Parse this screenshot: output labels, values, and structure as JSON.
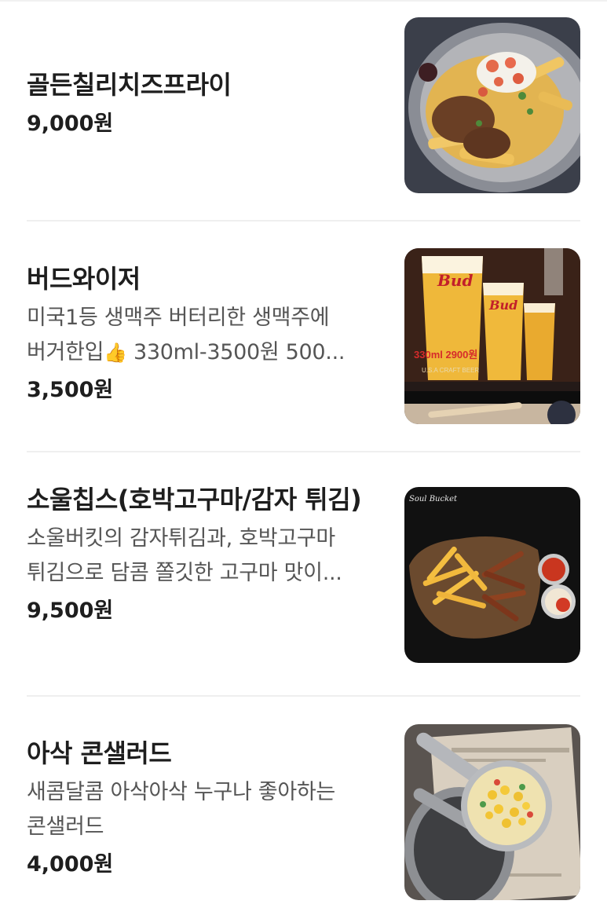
{
  "menu": {
    "items": [
      {
        "name": "골든칠리치즈프라이",
        "description": "",
        "price": "9,000원",
        "image_icon": "chili-cheese-fries-photo"
      },
      {
        "name": "버드와이저",
        "description_line1": "미국1등 생맥주 버터리한 생맥주에",
        "description_line2_prefix": "버거한입",
        "description_emoji": "👍",
        "description_line2_suffix": " 330ml-3500원 500...",
        "price": "3,500원",
        "image_icon": "budweiser-beer-photo",
        "image_text_brand": "Bud",
        "image_text_price": "330ml 2900원",
        "image_text_sub": "U.S.A CRAFT BEER"
      },
      {
        "name": "소울칩스(호박고구마/감자 튀김)",
        "description": "소울버킷의 감자튀김과, 호박고구마 튀김으로 담콤 쫄깃한 고구마 맛이...",
        "price": "9,500원",
        "image_icon": "soul-chips-photo",
        "image_text_logo": "Soul Bucket"
      },
      {
        "name": "아삭 콘샐러드",
        "description": "새콤달콤 아삭아삭 누구나 좋아하는 콘샐러드",
        "price": "4,000원",
        "image_icon": "corn-salad-photo"
      }
    ]
  },
  "colors": {
    "text_primary": "#1e1e1e",
    "text_secondary": "#555555",
    "divider": "#efefef"
  }
}
